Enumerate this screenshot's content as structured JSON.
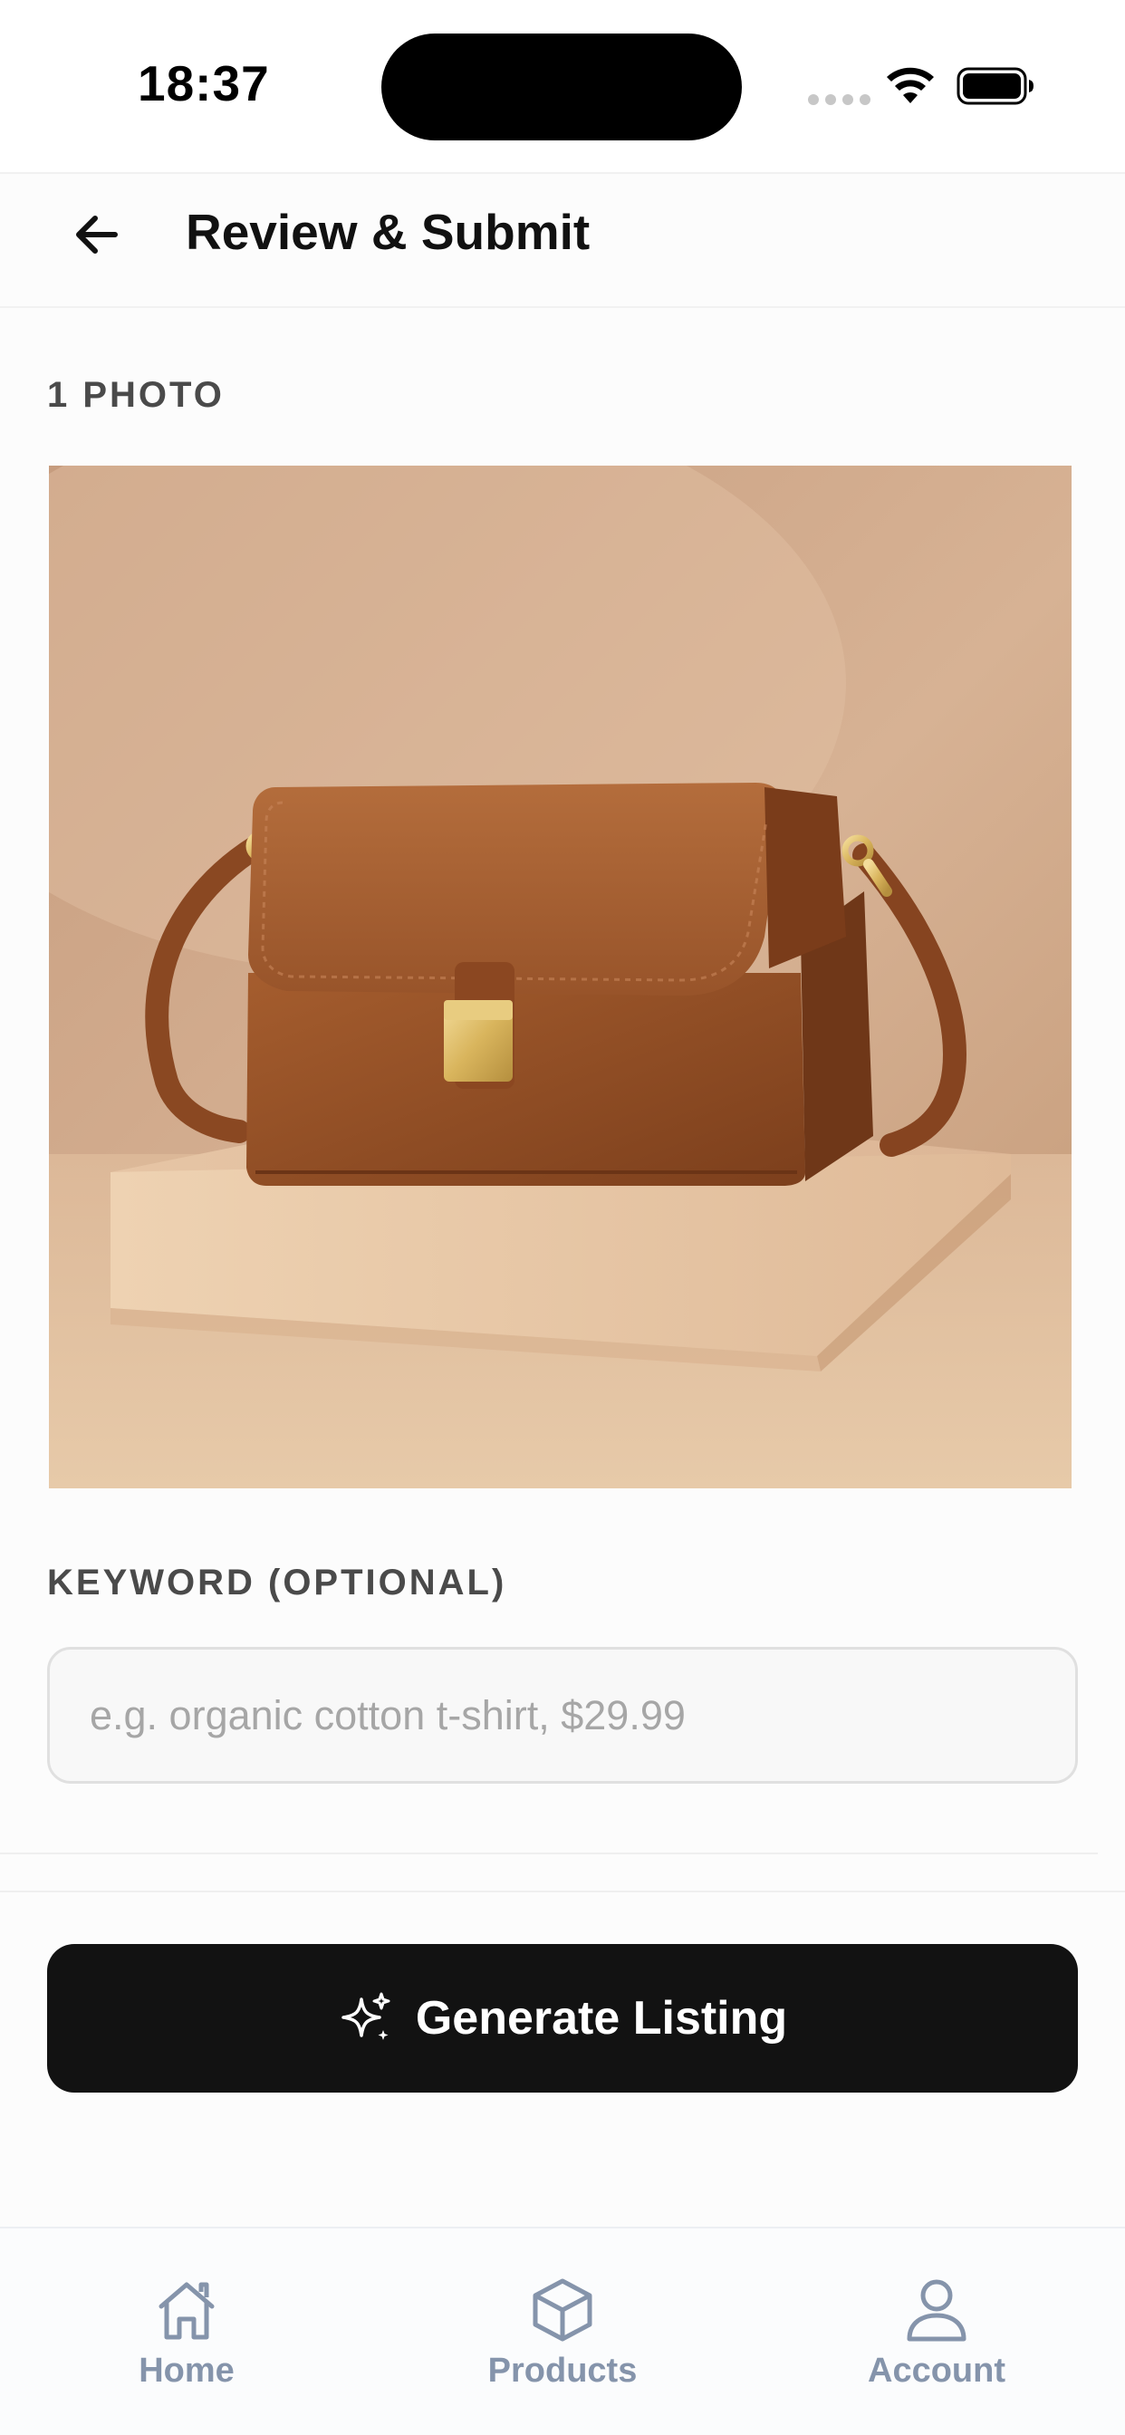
{
  "status_bar": {
    "time": "18:37"
  },
  "header": {
    "title": "Review & Submit",
    "back_icon": "arrow-left-icon"
  },
  "photos": {
    "count_label": "1 PHOTO",
    "items": [
      {
        "description_icon": "product-photo-brown-leather-crossbody-bag"
      }
    ]
  },
  "keyword": {
    "label": "KEYWORD (OPTIONAL)",
    "value": "",
    "placeholder": "e.g. organic cotton t-shirt, $29.99"
  },
  "generate_button": {
    "label": "Generate Listing",
    "icon": "sparkles-icon"
  },
  "bottom_nav": {
    "items": [
      {
        "label": "Home",
        "icon": "home-icon"
      },
      {
        "label": "Products",
        "icon": "box-icon"
      },
      {
        "label": "Account",
        "icon": "user-icon"
      }
    ]
  },
  "colors": {
    "primary_button": "#121212",
    "nav_inactive": "#8594ab",
    "section_label": "#4a4a4a",
    "background": "#fcfcfc"
  }
}
